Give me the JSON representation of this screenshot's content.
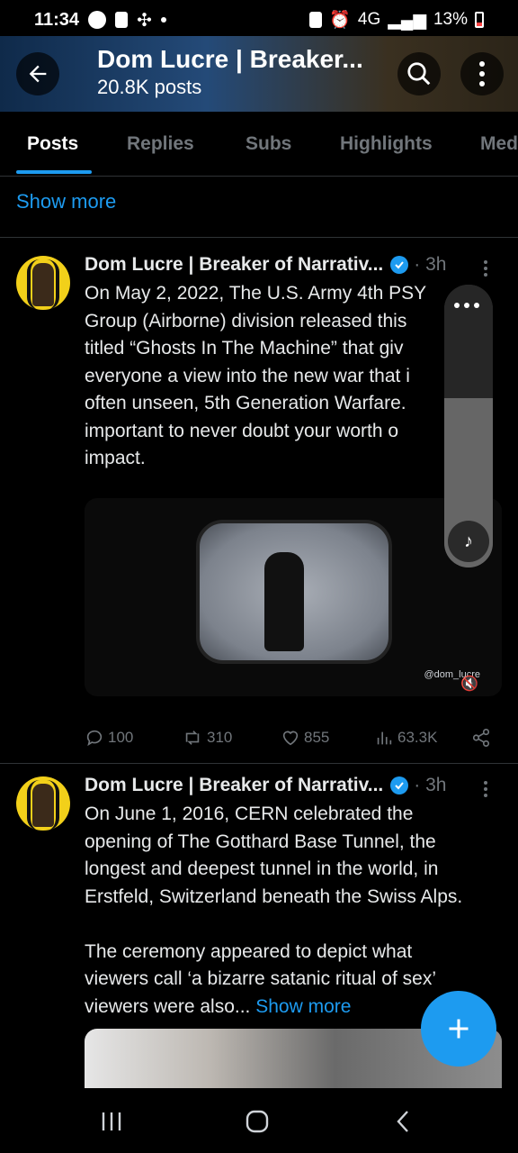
{
  "status_bar": {
    "time": "11:34",
    "network": "4G",
    "battery": "13%"
  },
  "header": {
    "title": "Dom Lucre | Breaker...",
    "subtitle": "20.8K posts"
  },
  "tabs": [
    {
      "label": "Posts",
      "active": true
    },
    {
      "label": "Replies"
    },
    {
      "label": "Subs"
    },
    {
      "label": "Highlights"
    },
    {
      "label": "Med"
    }
  ],
  "show_more_top": "Show more",
  "posts": [
    {
      "author": "Dom Lucre | Breaker of Narrativ...",
      "time": "· 3h",
      "text": "On May 2, 2022, The U.S. Army 4th PSY\nGroup (Airborne) division released this\ntitled “Ghosts In The Machine” that giv\neveryone a view into the new war that i\noften unseen, 5th Generation Warfare.\nimportant to never doubt your worth o\nimpact.",
      "media_watermark": "@dom_lucre",
      "actions": {
        "replies": "100",
        "reposts": "310",
        "likes": "855",
        "views": "63.3K"
      }
    },
    {
      "author": "Dom Lucre | Breaker of Narrativ...",
      "time": "· 3h",
      "text": "On June 1, 2016, CERN celebrated the\nopening of The Gotthard Base Tunnel, the\nlongest and deepest tunnel in the world, in\nErstfeld, Switzerland beneath the Swiss Alps.\n\nThe ceremony appeared to depict what\nviewers call ‘a bizarre satanic ritual of sex’\nviewers were also... ",
      "show_more": "Show more"
    }
  ],
  "colors": {
    "accent": "#1d9bf0",
    "background": "#000000",
    "muted": "#71767b",
    "text": "#e7e9ea"
  }
}
